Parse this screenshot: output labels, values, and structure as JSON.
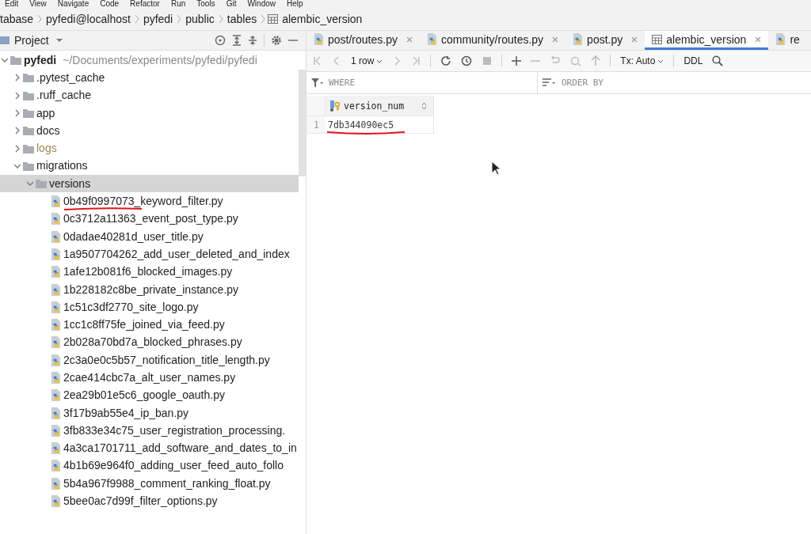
{
  "menu": [
    "Edit",
    "View",
    "Navigate",
    "Code",
    "Refactor",
    "Run",
    "Tools",
    "Git",
    "Window",
    "Help"
  ],
  "breadcrumb": [
    "tabase",
    "pyfedi@localhost",
    "pyfedi",
    "public",
    "tables",
    "alembic_version"
  ],
  "project_panel": {
    "title": "Project",
    "tree": [
      {
        "kind": "folder",
        "name": "pyfedi",
        "path": "~/Documents/experiments/pyfedi/pyfedi",
        "expanded": true,
        "selected": false,
        "children": [
          {
            "kind": "folder",
            "name": ".pytest_cache",
            "expanded": false,
            "selected": false,
            "ignored": false
          },
          {
            "kind": "folder",
            "name": ".ruff_cache",
            "expanded": false,
            "selected": false,
            "ignored": false
          },
          {
            "kind": "folder",
            "name": "app",
            "expanded": false,
            "selected": false,
            "ignored": false
          },
          {
            "kind": "folder",
            "name": "docs",
            "expanded": false,
            "selected": false,
            "ignored": false
          },
          {
            "kind": "folder",
            "name": "logs",
            "expanded": false,
            "selected": false,
            "ignored": true
          },
          {
            "kind": "folder",
            "name": "migrations",
            "expanded": true,
            "selected": false,
            "ignored": false,
            "children": [
              {
                "kind": "folder",
                "name": "versions",
                "expanded": true,
                "selected": true,
                "ignored": false,
                "children": [
                  {
                    "kind": "file",
                    "name": "0b49f0997073_keyword_filter.py",
                    "underlined": true
                  },
                  {
                    "kind": "file",
                    "name": "0c3712a11363_event_post_type.py",
                    "underlined": false
                  },
                  {
                    "kind": "file",
                    "name": "0dadae40281d_user_title.py",
                    "underlined": false
                  },
                  {
                    "kind": "file",
                    "name": "1a9507704262_add_user_deleted_and_index",
                    "underlined": false
                  },
                  {
                    "kind": "file",
                    "name": "1afe12b081f6_blocked_images.py",
                    "underlined": false
                  },
                  {
                    "kind": "file",
                    "name": "1b228182c8be_private_instance.py",
                    "underlined": false
                  },
                  {
                    "kind": "file",
                    "name": "1c51c3df2770_site_logo.py",
                    "underlined": false
                  },
                  {
                    "kind": "file",
                    "name": "1cc1c8ff75fe_joined_via_feed.py",
                    "underlined": false
                  },
                  {
                    "kind": "file",
                    "name": "2b028a70bd7a_blocked_phrases.py",
                    "underlined": false
                  },
                  {
                    "kind": "file",
                    "name": "2c3a0e0c5b57_notification_title_length.py",
                    "underlined": false
                  },
                  {
                    "kind": "file",
                    "name": "2cae414cbc7a_alt_user_names.py",
                    "underlined": false
                  },
                  {
                    "kind": "file",
                    "name": "2ea29b01e5c6_google_oauth.py",
                    "underlined": false
                  },
                  {
                    "kind": "file",
                    "name": "3f17b9ab55e4_ip_ban.py",
                    "underlined": false
                  },
                  {
                    "kind": "file",
                    "name": "3fb833e34c75_user_registration_processing.",
                    "underlined": false
                  },
                  {
                    "kind": "file",
                    "name": "4a3ca1701711_add_software_and_dates_to_in",
                    "underlined": false
                  },
                  {
                    "kind": "file",
                    "name": "4b1b69e964f0_adding_user_feed_auto_follo",
                    "underlined": false
                  },
                  {
                    "kind": "file",
                    "name": "5b4a967f9988_comment_ranking_float.py",
                    "underlined": false
                  },
                  {
                    "kind": "file",
                    "name": "5bee0ac7d99f_filter_options.py",
                    "underlined": false
                  }
                ]
              }
            ]
          }
        ]
      }
    ]
  },
  "editor_tabs": [
    {
      "label": "post/routes.py",
      "kind": "python",
      "selected": false
    },
    {
      "label": "community/routes.py",
      "kind": "python",
      "selected": false
    },
    {
      "label": "post.py",
      "kind": "python",
      "selected": false
    },
    {
      "label": "alembic_version",
      "kind": "table",
      "selected": true
    },
    {
      "label": "re",
      "kind": "python",
      "selected": false
    }
  ],
  "toolbar": {
    "rows": "1 row",
    "tx": "Tx: Auto",
    "ddl": "DDL"
  },
  "filter": {
    "where": {
      "placeholder": "WHERE"
    },
    "order_by": {
      "placeholder": "ORDER BY"
    }
  },
  "grid": {
    "columns": [
      "version_num"
    ],
    "rows": [
      {
        "number": "1",
        "cells": [
          "7db344090ec5"
        ],
        "underlined": true
      }
    ]
  }
}
